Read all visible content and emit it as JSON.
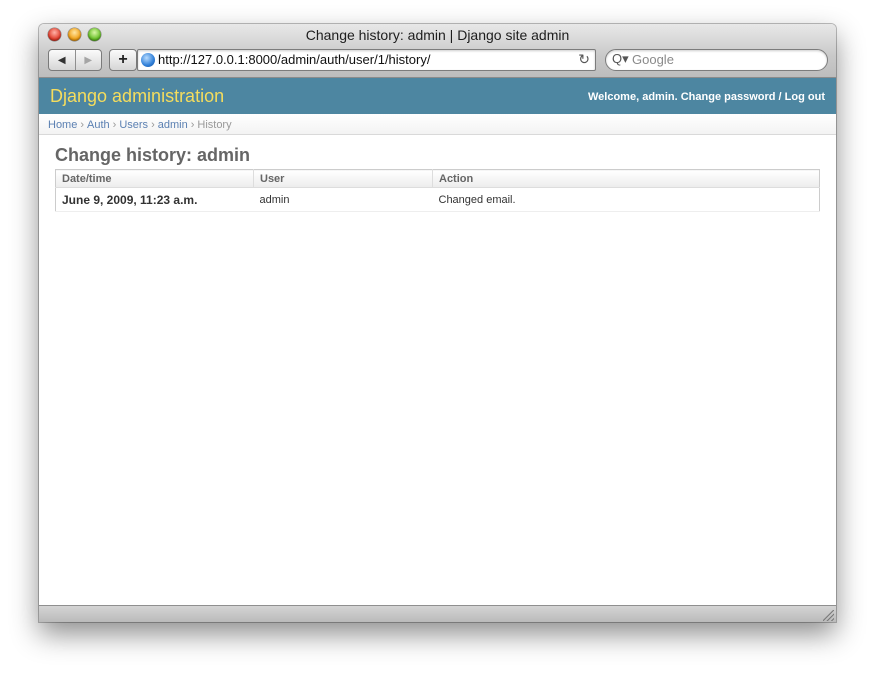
{
  "browser": {
    "window_title": "Change history: admin | Django site admin",
    "url": "http://127.0.0.1:8000/admin/auth/user/1/history/",
    "search_placeholder": "Google",
    "back_glyph": "◀",
    "forward_glyph": "▶",
    "add_glyph": "+",
    "reload_glyph": "↻",
    "search_glyph": "Q▾"
  },
  "django": {
    "branding": "Django administration",
    "user_tools": {
      "welcome": "Welcome,",
      "username": "admin",
      "period": ".",
      "change_password": "Change password",
      "separator": "/",
      "log_out": "Log out"
    },
    "breadcrumbs": {
      "items": [
        {
          "label": "Home"
        },
        {
          "label": "Auth"
        },
        {
          "label": "Users"
        },
        {
          "label": "admin"
        }
      ],
      "separator": "›",
      "current": "History"
    },
    "title": "Change history: admin",
    "table": {
      "headers": [
        "Date/time",
        "User",
        "Action"
      ],
      "rows": [
        {
          "datetime": "June 9, 2009, 11:23 a.m.",
          "user": "admin",
          "action": "Changed email."
        }
      ]
    }
  },
  "colors": {
    "header_bg": "#4d86a1",
    "branding": "#f5dd5d",
    "link": "#5b80b2"
  }
}
